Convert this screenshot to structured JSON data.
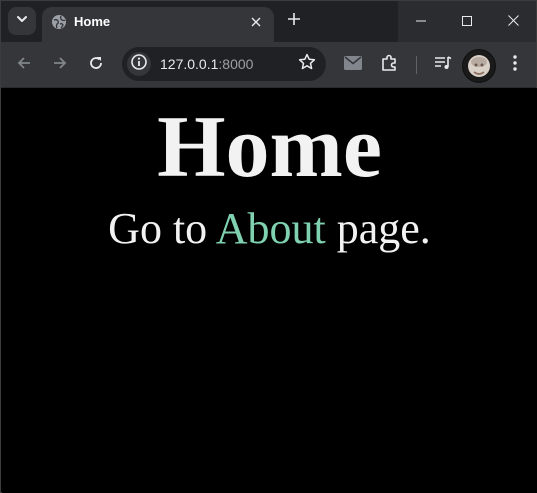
{
  "browser": {
    "tab": {
      "title": "Home"
    },
    "address": {
      "host": "127.0.0.1",
      "port": ":8000"
    }
  },
  "page": {
    "heading": "Home",
    "paragraph": {
      "prefix": "Go to ",
      "link_text": "About",
      "suffix": " page."
    }
  },
  "colors": {
    "link": "#7fd1b0",
    "text": "#f2f2f2",
    "background": "#000000"
  },
  "icons": [
    "tab-search-icon",
    "globe-icon",
    "close-icon",
    "plus-icon",
    "minimize-icon",
    "maximize-icon",
    "back-arrow-icon",
    "forward-arrow-icon",
    "reload-icon",
    "site-info-icon",
    "star-icon",
    "mail-icon",
    "extensions-icon",
    "media-queue-icon",
    "profile-avatar",
    "more-menu-icon"
  ]
}
